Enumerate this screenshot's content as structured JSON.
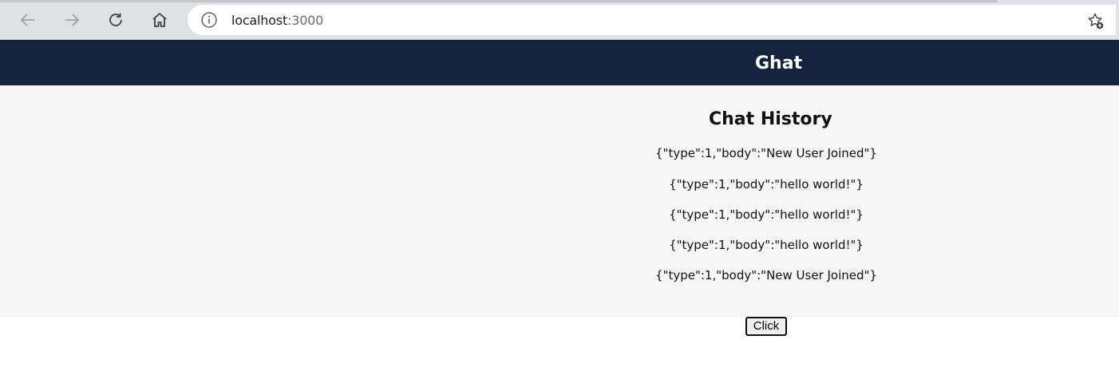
{
  "browser": {
    "url_host": "localhost",
    "url_port": ":3000",
    "icons": {
      "back": "arrow-left-icon",
      "forward": "arrow-right-icon",
      "reload": "reload-icon",
      "home": "home-icon",
      "site_info": "info-icon",
      "favorite": "star-add-icon"
    }
  },
  "header": {
    "title": "Ghat",
    "background": "#15223b"
  },
  "chat_history": {
    "heading": "Chat History",
    "messages": [
      "{\"type\":1,\"body\":\"New User Joined\"}",
      "{\"type\":1,\"body\":\"hello world!\"}",
      "{\"type\":1,\"body\":\"hello world!\"}",
      "{\"type\":1,\"body\":\"hello world!\"}",
      "{\"type\":1,\"body\":\"New User Joined\"}"
    ]
  },
  "controls": {
    "click_label": "Click"
  }
}
